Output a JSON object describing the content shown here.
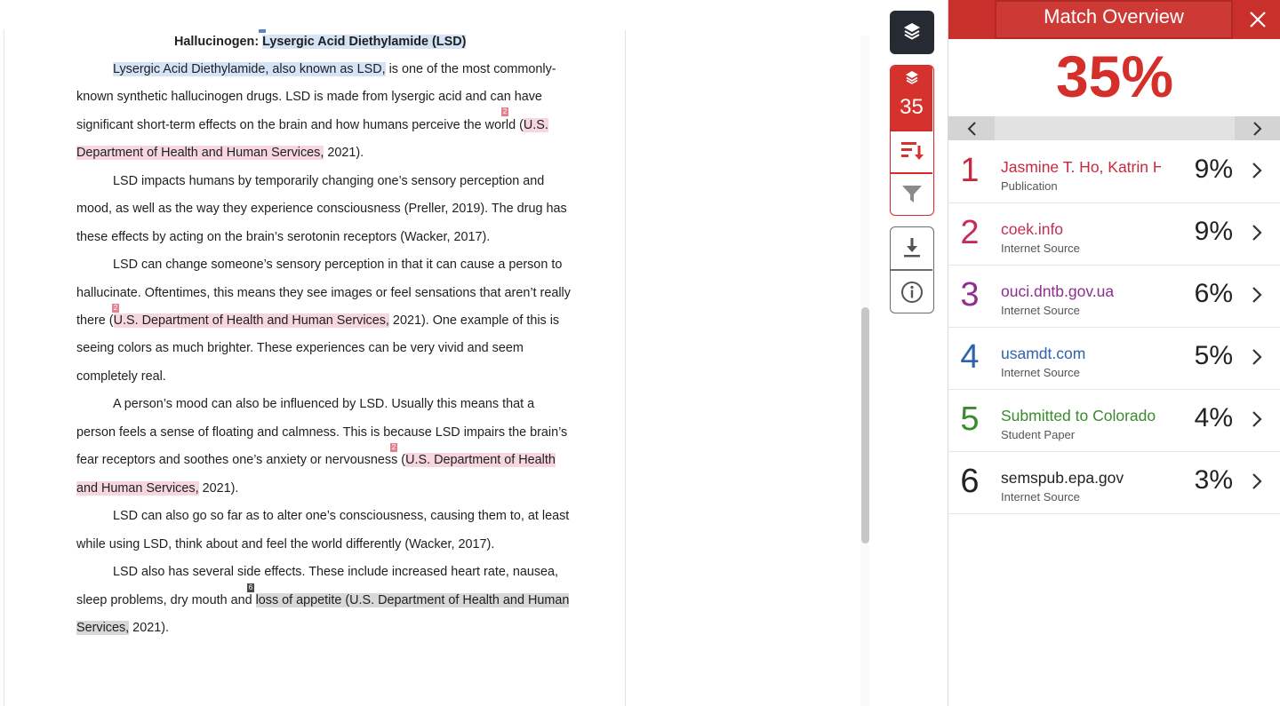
{
  "document": {
    "title_prefix": "Hallucinogen: ",
    "title_highlight": "Lysergic Acid Diethylamide (LSD)",
    "lines": {
      "l1a": "Lysergic Acid Diethylamide, also known as LSD,",
      "l1b": " is one of the most commonly-",
      "l2": "known synthetic hallucinogen drugs. LSD is made from lysergic acid and can have",
      "l3a": "significant short-term effects on the brain and how humans perceive the world (",
      "l3b": "U.S.",
      "l4a": "Department of Health and Human Services,",
      "l4b": " 2021).",
      "l5": "LSD impacts humans by temporarily changing one’s sensory perception and",
      "l6": "mood, as well as the way they experience consciousness (Preller, 2019). The drug has",
      "l7": "these effects by acting on the brain’s serotonin receptors (Wacker, 2017).",
      "l8": "LSD can change someone’s sensory perception in that it can cause a person to",
      "l9": "hallucinate. Oftentimes, this means they see images or feel sensations that aren’t really",
      "l10a": "there (",
      "l10b": "U.S. Department of Health and Human Services,",
      "l10c": " 2021). One example of this is",
      "l11": "seeing colors as much brighter. These experiences can be very vivid and seem",
      "l12": "completely real.",
      "l13": "A person’s mood can also be influenced by LSD. Usually this means that a",
      "l14": "person feels a sense of floating and calmness. This is because LSD impairs the brain’s",
      "l15a": "fear receptors and soothes one’s anxiety or nervousness (",
      "l15b": "U.S. Department of Health",
      "l16a": "and Human Services,",
      "l16b": " 2021).",
      "l17": "LSD can also go so far as to alter one’s consciousness, causing them to, at least",
      "l18": "while using LSD, think about and feel the world differently (Wacker, 2017).",
      "l19": "LSD also has several side effects. These include increased heart rate, nausea,",
      "l20a": "sleep problems, dry mouth and ",
      "l20b": "loss of appetite (U.S. Department of Health and Human",
      "l21a": "Services,",
      "l21b": " 2021)."
    },
    "markers": {
      "m1": "2",
      "m2": "2",
      "m3": "2",
      "m4": "6"
    }
  },
  "toolbar": {
    "match_count": "35",
    "icons": [
      "layers-icon",
      "sort-icon",
      "filter-icon",
      "download-icon",
      "info-icon"
    ]
  },
  "panel": {
    "title": "Match Overview",
    "overall_percent": "35%",
    "sources": [
      {
        "num": "1",
        "name": "Jasmine T. Ho, Katrin H...",
        "type": "Publication",
        "percent": "9%",
        "color": "#c62a3f"
      },
      {
        "num": "2",
        "name": "coek.info",
        "type": "Internet Source",
        "percent": "9%",
        "color": "#c82c54"
      },
      {
        "num": "3",
        "name": "ouci.dntb.gov.ua",
        "type": "Internet Source",
        "percent": "6%",
        "color": "#8e2e8f"
      },
      {
        "num": "4",
        "name": "usamdt.com",
        "type": "Internet Source",
        "percent": "5%",
        "color": "#2e63ad"
      },
      {
        "num": "5",
        "name": "Submitted to Colorado ...",
        "type": "Student Paper",
        "percent": "4%",
        "color": "#3a8a2e"
      },
      {
        "num": "6",
        "name": "semspub.epa.gov",
        "type": "Internet Source",
        "percent": "3%",
        "color": "#222222"
      }
    ]
  }
}
